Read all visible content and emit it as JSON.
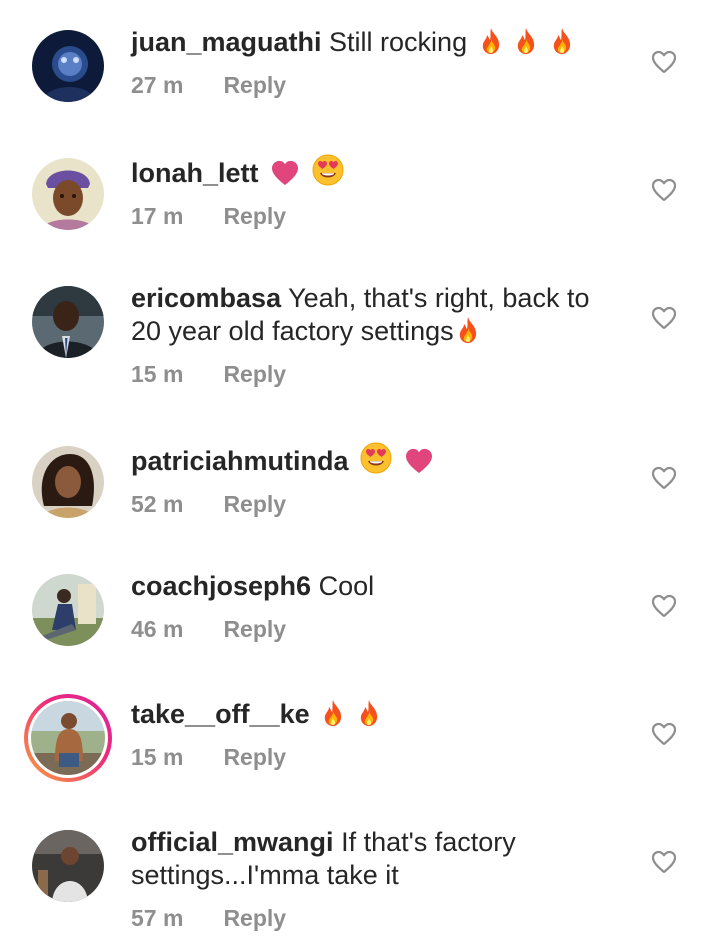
{
  "comments": [
    {
      "username": "juan_maguathi",
      "text": "Still rocking",
      "emojis": [
        "fire-emoji",
        "fire-emoji",
        "fire-emoji"
      ],
      "time": "27 m",
      "reply": "Reply"
    },
    {
      "username": "lonah_lett",
      "text": "",
      "emojis": [
        "heart-emoji",
        "heart-eyes-emoji"
      ],
      "time": "17 m",
      "reply": "Reply"
    },
    {
      "username": "ericombasa",
      "text_line1": "Yeah, that's right, back to",
      "text_line2": "20 year old factory settings",
      "emojis": [
        "fire-emoji"
      ],
      "time": "15 m",
      "reply": "Reply"
    },
    {
      "username": "patriciahmutinda",
      "text": "",
      "emojis": [
        "heart-eyes-emoji",
        "heart-emoji"
      ],
      "time": "52 m",
      "reply": "Reply"
    },
    {
      "username": "coachjoseph6",
      "text": "Cool",
      "emojis": [],
      "time": "46 m",
      "reply": "Reply"
    },
    {
      "username": "take__off__ke",
      "text": "",
      "emojis": [
        "fire-emoji",
        "fire-emoji"
      ],
      "time": "15 m",
      "reply": "Reply"
    },
    {
      "username": "official_mwangi",
      "text_line1": "If that's factory",
      "text_line2": "settings...I'mma take it",
      "emojis": [],
      "time": "57 m",
      "reply": "Reply"
    }
  ],
  "colors": {
    "text": "#262626",
    "meta": "#8e8e8e",
    "heart_emoji": "#e0457b",
    "fire": "#f4511e",
    "story_ring": "#ee2a7b"
  },
  "icons": {
    "like": "heart-outline-icon"
  }
}
